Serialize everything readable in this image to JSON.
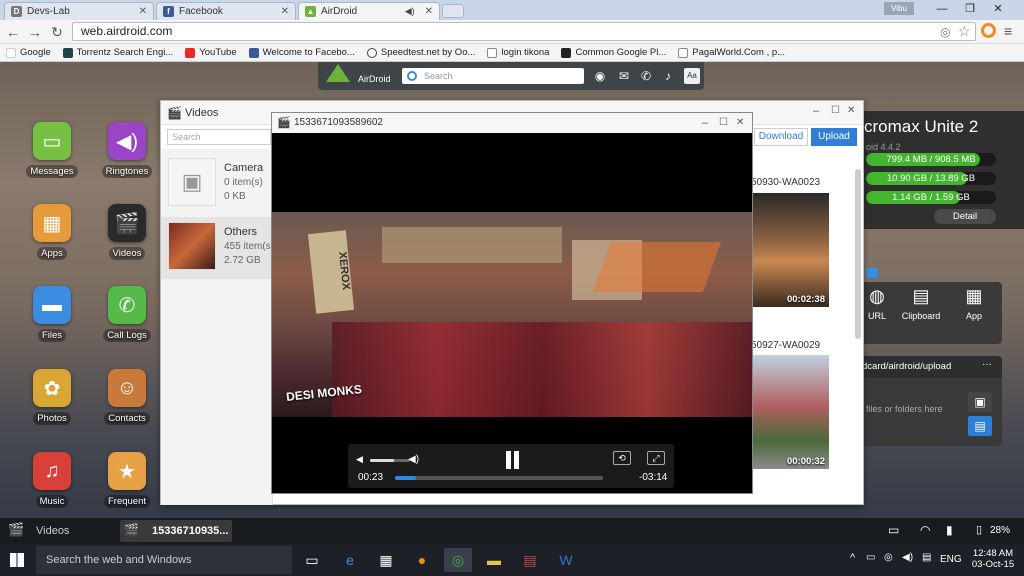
{
  "browser": {
    "tabs": [
      {
        "label": "Devs-Lab"
      },
      {
        "label": "Facebook"
      },
      {
        "label": "AirDroid"
      }
    ],
    "user_badge": "Vibu",
    "address": "web.airdroid.com",
    "bookmarks": [
      {
        "label": "Google"
      },
      {
        "label": "Torrentz Search Engi..."
      },
      {
        "label": "YouTube"
      },
      {
        "label": "Welcome to Facebo..."
      },
      {
        "label": "Speedtest.net by Oo..."
      },
      {
        "label": "login tikona"
      },
      {
        "label": "Common Google Pl..."
      },
      {
        "label": "PagalWorld.Com , p..."
      }
    ]
  },
  "airdroid": {
    "logo": "AirDroid",
    "search_placeholder": "Search",
    "desktop_icons": [
      {
        "label": "Messages",
        "icon": "messages-icon"
      },
      {
        "label": "Ringtones",
        "icon": "ringtones-icon"
      },
      {
        "label": "Apps",
        "icon": "apps-icon"
      },
      {
        "label": "Videos",
        "icon": "videos-icon"
      },
      {
        "label": "Files",
        "icon": "files-icon"
      },
      {
        "label": "Call Logs",
        "icon": "call-logs-icon"
      },
      {
        "label": "Photos",
        "icon": "photos-icon"
      },
      {
        "label": "Contacts",
        "icon": "contacts-icon"
      },
      {
        "label": "Music",
        "icon": "music-icon"
      },
      {
        "label": "Frequent",
        "icon": "frequent-icon"
      }
    ],
    "videos_window": {
      "title": "Videos",
      "search_placeholder": "Search",
      "download_label": "Download",
      "upload_label": "Upload",
      "albums": [
        {
          "name": "Camera",
          "count": "0 item(s)",
          "size": "0 KB"
        },
        {
          "name": "Others",
          "count": "455 item(s)",
          "size": "2.72 GB"
        }
      ],
      "videos": [
        {
          "name": "50930-WA0023",
          "duration": "00:02:38"
        },
        {
          "name": "50927-WA0029",
          "duration": "00:00:32"
        }
      ]
    },
    "player": {
      "title": "1533671093589602",
      "watermark": "DESI MONKS",
      "elapsed": "00:23",
      "remaining": "-03:14",
      "progress": 0.1,
      "volume": 0.6
    },
    "device": {
      "name": "cromax Unite 2",
      "os": "oid 4.4.2",
      "storage": [
        {
          "text": "799.4 MB / 908.5 MB",
          "fill": 0.88
        },
        {
          "text": "10.90 GB / 13.89 GB",
          "fill": 0.78
        },
        {
          "text": "1.14 GB / 1.59 GB",
          "fill": 0.72
        }
      ],
      "detail_label": "Detail"
    },
    "tools": [
      {
        "label": "URL",
        "icon": "url-icon"
      },
      {
        "label": "Clipboard",
        "icon": "clipboard-icon"
      },
      {
        "label": "App",
        "icon": "app-icon"
      }
    ],
    "upload_path": "dcard/airdroid/upload",
    "upload_hint": "files or folders here",
    "dock": {
      "items": [
        {
          "label": "Videos"
        },
        {
          "label": "15336710935..."
        }
      ],
      "battery": "28%"
    }
  },
  "taskbar": {
    "search_placeholder": "Search the web and Windows",
    "language": "ENG",
    "time": "12:48 AM",
    "date": "03-Oct-15"
  }
}
